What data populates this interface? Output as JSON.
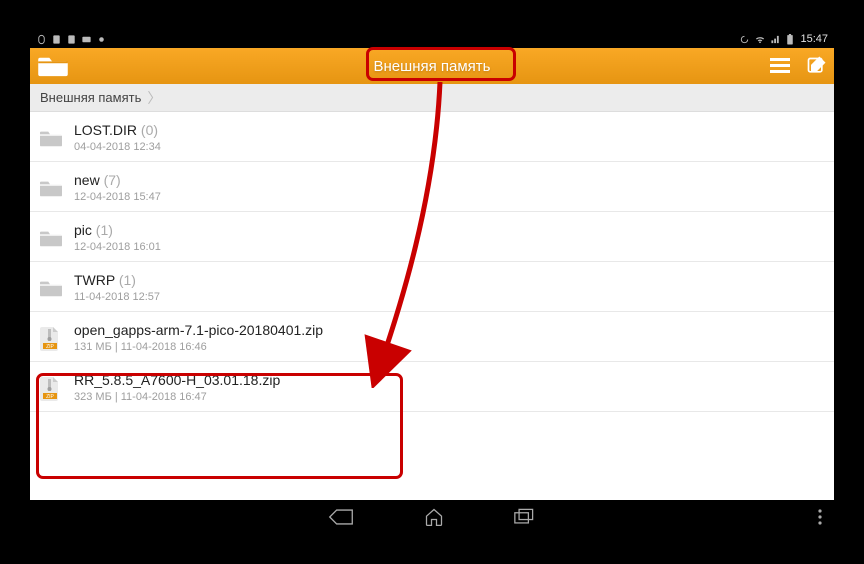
{
  "status": {
    "time": "15:47"
  },
  "header": {
    "title": "Внешняя память"
  },
  "breadcrumb": {
    "label": "Внешняя память"
  },
  "items": [
    {
      "type": "folder",
      "name": "LOST.DIR",
      "count": "(0)",
      "meta": "04-04-2018 12:34"
    },
    {
      "type": "folder",
      "name": "new",
      "count": "(7)",
      "meta": "12-04-2018 15:47"
    },
    {
      "type": "folder",
      "name": "pic",
      "count": "(1)",
      "meta": "12-04-2018 16:01"
    },
    {
      "type": "folder",
      "name": "TWRP",
      "count": "(1)",
      "meta": "11-04-2018 12:57"
    },
    {
      "type": "zip",
      "name": "open_gapps-arm-7.1-pico-20180401.zip",
      "count": "",
      "meta": "131 МБ | 11-04-2018 16:46"
    },
    {
      "type": "zip",
      "name": "RR_5.8.5_A7600-H_03.01.18.zip",
      "count": "",
      "meta": "323 МБ | 11-04-2018 16:47"
    }
  ]
}
